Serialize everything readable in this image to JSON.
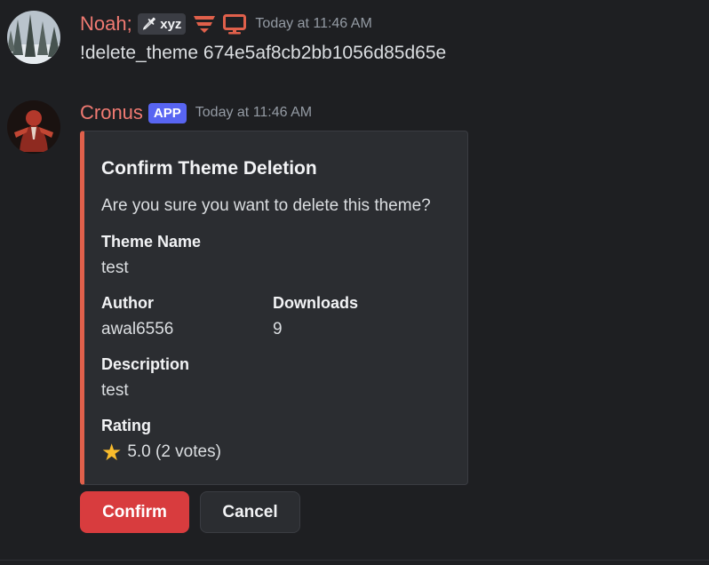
{
  "messages": [
    {
      "username": "Noah;",
      "tag": "xyz",
      "timestamp": "Today at 11:46 AM",
      "content": "!delete_theme 674e5af8cb2bb1056d85d65e"
    },
    {
      "username": "Cronus",
      "badge": "APP",
      "timestamp": "Today at 11:46 AM",
      "embed": {
        "accent_color": "#e0604b",
        "title": "Confirm Theme Deletion",
        "description": "Are you sure you want to delete this theme?",
        "fields": [
          {
            "name": "Theme Name",
            "value": "test"
          },
          {
            "name": "Author",
            "value": "awal6556"
          },
          {
            "name": "Downloads",
            "value": "9"
          },
          {
            "name": "Description",
            "value": "test"
          },
          {
            "name": "Rating",
            "value": "5.0 (2 votes)",
            "icon": "star-icon"
          }
        ]
      },
      "buttons": [
        {
          "label": "Confirm",
          "style": "danger",
          "color": "#d83c3e"
        },
        {
          "label": "Cancel",
          "style": "secondary"
        }
      ]
    }
  ],
  "colors": {
    "background": "#1e1f22",
    "username": "#f07a72",
    "app_badge": "#5865f2",
    "embed_bg": "#2b2d31"
  }
}
